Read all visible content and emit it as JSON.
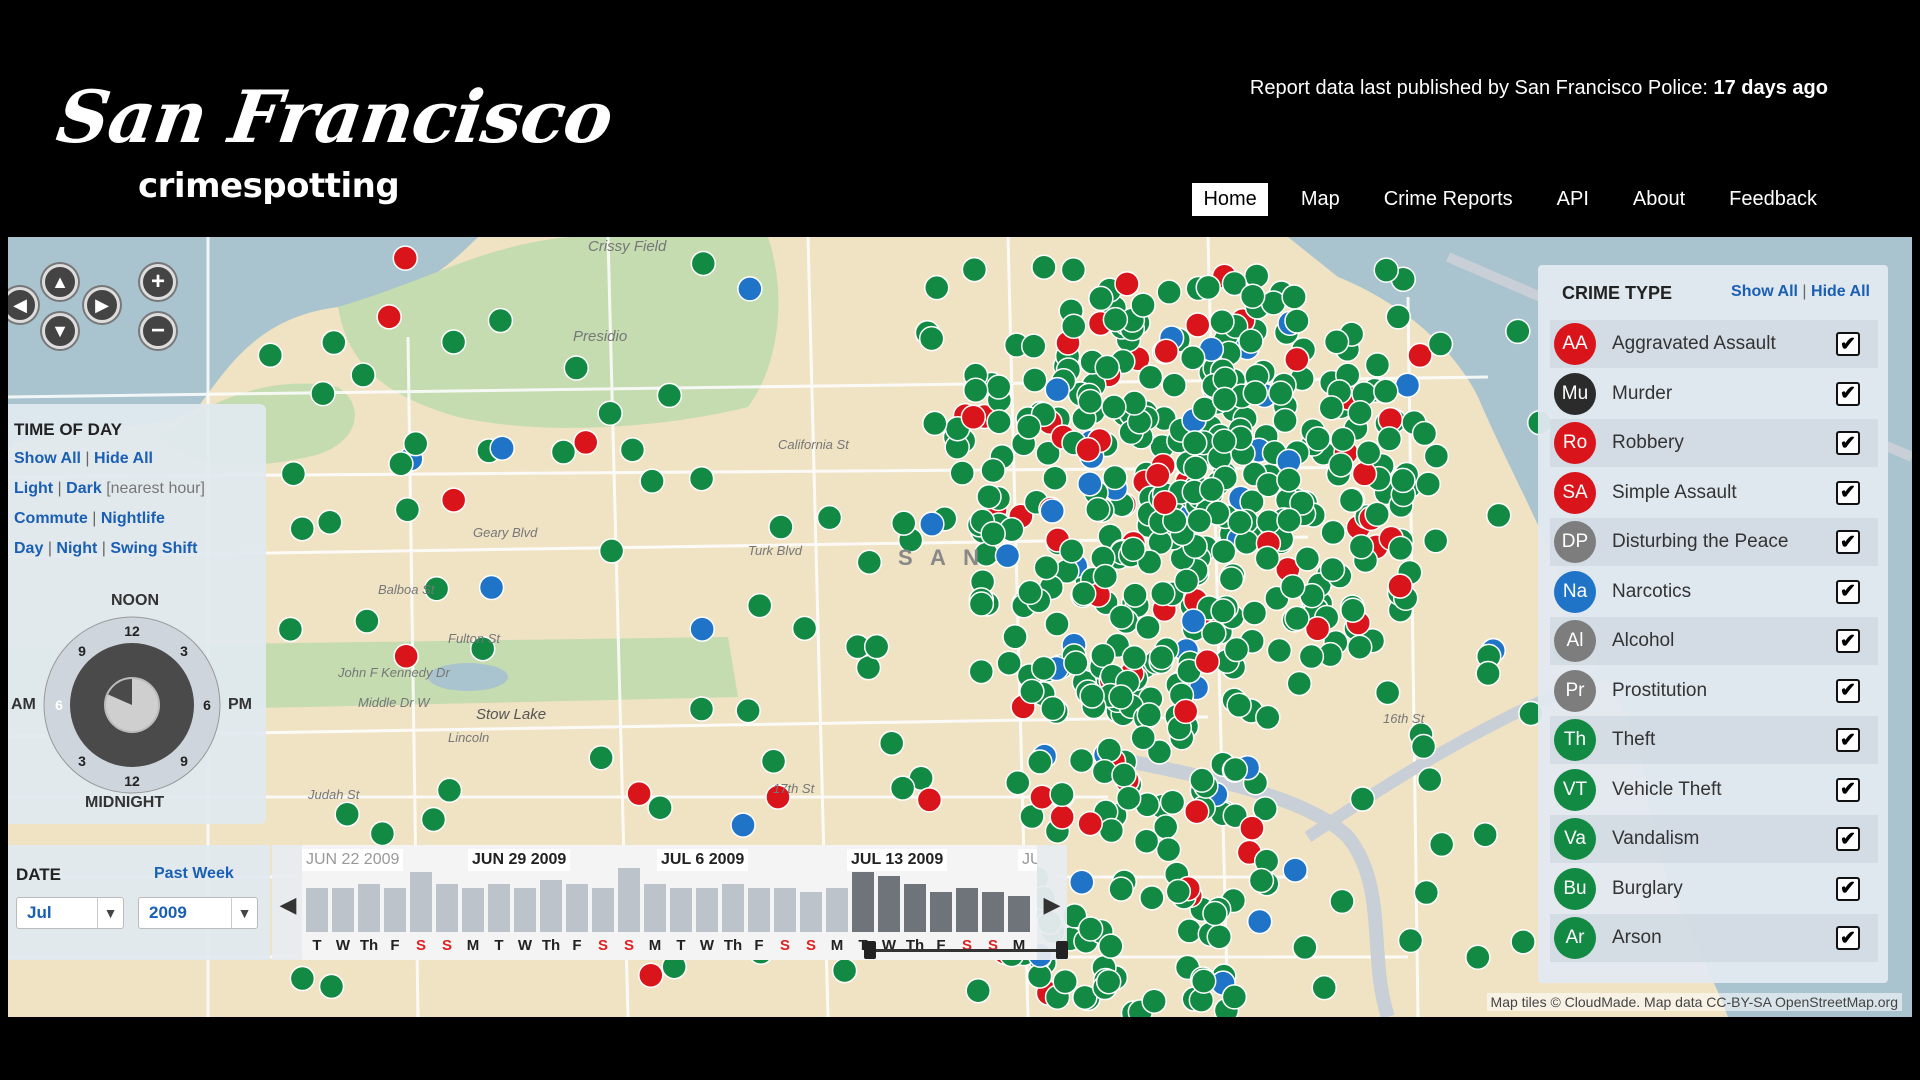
{
  "header": {
    "logo_script": "San Francisco",
    "logo_sub": "crimespotting",
    "status_prefix": "Report data last published by San Francisco Police:",
    "status_value": "17 days ago"
  },
  "nav": {
    "items": [
      {
        "label": "Home",
        "active": true
      },
      {
        "label": "Map"
      },
      {
        "label": "Crime Reports"
      },
      {
        "label": "API"
      },
      {
        "label": "About"
      },
      {
        "label": "Feedback"
      }
    ]
  },
  "map": {
    "labels": {
      "crissy_field": "Crissy Field",
      "presidio": "Presidio",
      "california_st": "California St",
      "geary_blvd": "Geary Blvd",
      "turk_blvd": "Turk Blvd",
      "balboa_st": "Balboa St",
      "fulton_st": "Fulton St",
      "jfk_dr": "John F Kennedy Dr",
      "middle_dr": "Middle Dr W",
      "stow_lake": "Stow Lake",
      "lincoln": "Lincoln",
      "judah": "Judah St",
      "seventeenth": "17th St",
      "sixteenth": "16th St",
      "san": "S A N"
    },
    "attribution": "Map tiles © CloudMade. Map data CC-BY-SA OpenStreetMap.org"
  },
  "time_of_day": {
    "title": "TIME OF DAY",
    "show_all": "Show All",
    "hide_all": "Hide All",
    "light": "Light",
    "dark": "Dark",
    "nearest_hour": "[nearest hour]",
    "commute": "Commute",
    "nightlife": "Nightlife",
    "day": "Day",
    "night": "Night",
    "swing_shift": "Swing Shift",
    "noon": "NOON",
    "midnight": "MIDNIGHT",
    "am": "AM",
    "pm": "PM",
    "clock": {
      "top": "12",
      "bottom": "12",
      "left": "6",
      "right": "6",
      "nine_a": "9",
      "three_a": "3",
      "three_b": "3",
      "nine_b": "9"
    }
  },
  "date": {
    "title": "DATE",
    "past_week": "Past Week",
    "month": "Jul",
    "year": "2009"
  },
  "timeline": {
    "dates": [
      "JUN 22 2009",
      "JUN 29 2009",
      "JUL 6 2009",
      "JUL 13 2009",
      "JU"
    ],
    "days": [
      "T",
      "W",
      "Th",
      "F",
      "S",
      "S",
      "M",
      "T",
      "W",
      "Th",
      "F",
      "S",
      "S",
      "M",
      "T",
      "W",
      "Th",
      "F",
      "S",
      "S",
      "M",
      "T",
      "W",
      "Th",
      "F",
      "S",
      "S",
      "M"
    ],
    "bar_levels": [
      0.55,
      0.55,
      0.6,
      0.55,
      0.75,
      0.6,
      0.55,
      0.6,
      0.55,
      0.65,
      0.6,
      0.55,
      0.8,
      0.6,
      0.55,
      0.55,
      0.6,
      0.55,
      0.55,
      0.5,
      0.55,
      0.75,
      0.7,
      0.6,
      0.5,
      0.55,
      0.5,
      0.45
    ]
  },
  "crime_type": {
    "title": "CRIME TYPE",
    "show_all": "Show All",
    "hide_all": "Hide All",
    "items": [
      {
        "abbr": "AA",
        "label": "Aggravated Assault",
        "color": "#d9151b",
        "checked": true
      },
      {
        "abbr": "Mu",
        "label": "Murder",
        "color": "#2b2b2b",
        "checked": true
      },
      {
        "abbr": "Ro",
        "label": "Robbery",
        "color": "#d9151b",
        "checked": true
      },
      {
        "abbr": "SA",
        "label": "Simple Assault",
        "color": "#d9151b",
        "checked": true
      },
      {
        "abbr": "DP",
        "label": "Disturbing the Peace",
        "color": "#7d7d7d",
        "checked": true
      },
      {
        "abbr": "Na",
        "label": "Narcotics",
        "color": "#1f74c8",
        "checked": true
      },
      {
        "abbr": "Al",
        "label": "Alcohol",
        "color": "#7d7d7d",
        "checked": true
      },
      {
        "abbr": "Pr",
        "label": "Prostitution",
        "color": "#7d7d7d",
        "checked": true
      },
      {
        "abbr": "Th",
        "label": "Theft",
        "color": "#138a43",
        "checked": true
      },
      {
        "abbr": "VT",
        "label": "Vehicle Theft",
        "color": "#138a43",
        "checked": true
      },
      {
        "abbr": "Va",
        "label": "Vandalism",
        "color": "#138a43",
        "checked": true
      },
      {
        "abbr": "Bu",
        "label": "Burglary",
        "color": "#138a43",
        "checked": true
      },
      {
        "abbr": "Ar",
        "label": "Arson",
        "color": "#138a43",
        "checked": true
      }
    ]
  },
  "colors": {
    "property_crime": "#138a43",
    "violent_crime": "#d9151b",
    "narcotics": "#1f74c8",
    "land": "#efe3c4",
    "water": "#a9c3cf",
    "park": "#c5dbb0"
  }
}
